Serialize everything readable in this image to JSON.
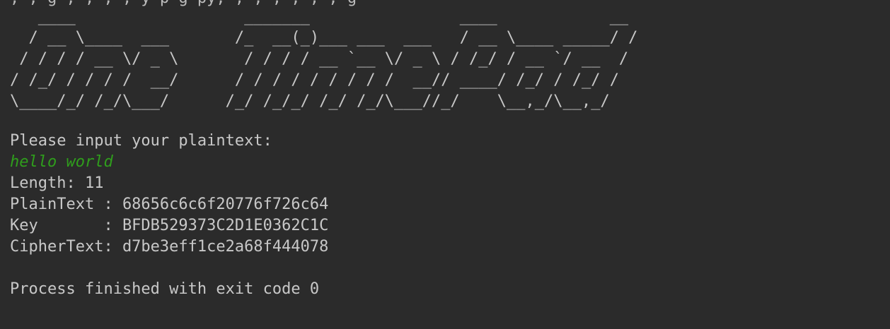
{
  "console": {
    "clipped_top_line": ", , g , , , , y p g py, , , , , , , g",
    "banner_lines": [
      "   ____                  _______                ____            __",
      "  / __ \\____  ___       /_  __(_)___ ___  ___   / __ \\____ _____/ /",
      " / / / / __ \\/ _ \\       / / / / __ `__ \\/ _ \\ / /_/ / __ `/ __  /",
      "/ /_/ / / / /  __/      / / / / / / / / /  __// ____/ /_/ / /_/ /",
      "\\____/_/ /_/\\___/      /_/ /_/_/ /_/ /_/\\___//_/    \\__,_/\\__,_/"
    ],
    "prompt": "Please input your plaintext:",
    "user_input": "hello world",
    "length_line": "Length: 11",
    "plaintext_line": "PlainText : 68656c6c6f20776f726c64",
    "key_line": "Key       : BFDB529373C2D1E0362C1C",
    "ciphertext_line": "CipherText: d7be3eff1ce2a68f444078",
    "exit_line": "Process finished with exit code 0"
  }
}
